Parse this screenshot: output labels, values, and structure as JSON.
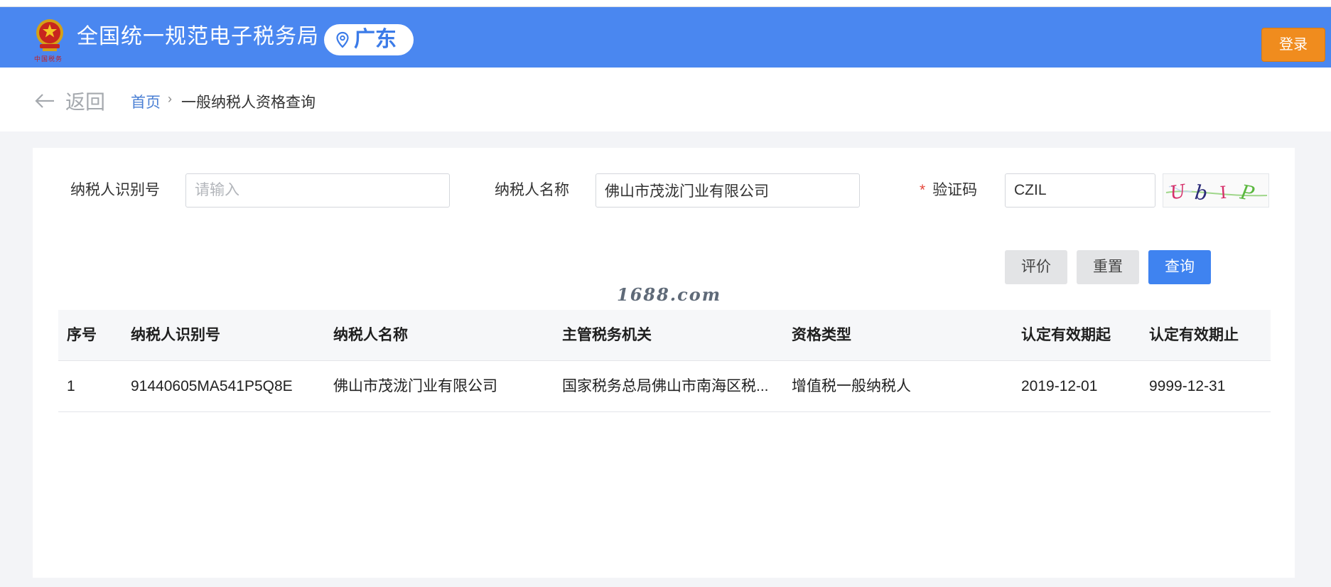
{
  "header": {
    "title": "全国统一规范电子税务局",
    "emblem_caption": "中国税务",
    "region": "广东",
    "login_label": "登录",
    "colors": {
      "bar": "#4a87f0",
      "login": "#f08c1e"
    }
  },
  "breadcrumb": {
    "back_label": "返回",
    "home": "首页",
    "separator": "›",
    "current": "一般纳税人资格查询"
  },
  "form": {
    "taxpayer_id": {
      "label": "纳税人识别号",
      "value": "",
      "placeholder": "请输入"
    },
    "taxpayer_name": {
      "label": "纳税人名称",
      "value": "佛山市茂泷门业有限公司"
    },
    "captcha": {
      "required_mark": "*",
      "label": "验证码",
      "value": "CZIL",
      "image_text": "UbIP"
    }
  },
  "actions": {
    "rate_label": "评价",
    "reset_label": "重置",
    "query_label": "查询"
  },
  "watermark": "1688.com",
  "table": {
    "columns": [
      "序号",
      "纳税人识别号",
      "纳税人名称",
      "主管税务机关",
      "资格类型",
      "认定有效期起",
      "认定有效期止"
    ],
    "rows": [
      [
        "1",
        "91440605MA541P5Q8E",
        "佛山市茂泷门业有限公司",
        "国家税务总局佛山市南海区税...",
        "增值税一般纳税人",
        "2019-12-01",
        "9999-12-31"
      ]
    ]
  }
}
